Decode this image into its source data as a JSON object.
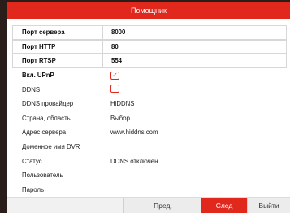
{
  "window": {
    "title": "Помощник"
  },
  "fields": [
    {
      "label": "Порт сервера",
      "value": "8000"
    },
    {
      "label": "Порт HTTP",
      "value": "80"
    },
    {
      "label": "Порт RTSP",
      "value": "554"
    }
  ],
  "upnp": {
    "label": "Вкл. UPnP",
    "checked": true,
    "check_glyph": "✓"
  },
  "ddns": {
    "label": "DDNS",
    "checked": false
  },
  "ddns_provider": {
    "label": "DDNS провайдер",
    "value": "HiDDNS"
  },
  "region": {
    "label": "Страна, область",
    "value": "Выбор"
  },
  "server_address": {
    "label": "Адрес сервера",
    "value": "www.hiddns.com"
  },
  "dvr_domain": {
    "label": "Доменное имя DVR",
    "value": ""
  },
  "status": {
    "label": "Статус",
    "value": "DDNS отключен."
  },
  "user": {
    "label": "Пользователь",
    "value": ""
  },
  "password": {
    "label": "Пароль",
    "value": ""
  },
  "buttons": {
    "prev": "Пред.",
    "next": "След",
    "exit": "Выйти"
  },
  "colors": {
    "accent": "#e0281d",
    "background": "#ffffff",
    "outer": "#2b1e1a"
  }
}
